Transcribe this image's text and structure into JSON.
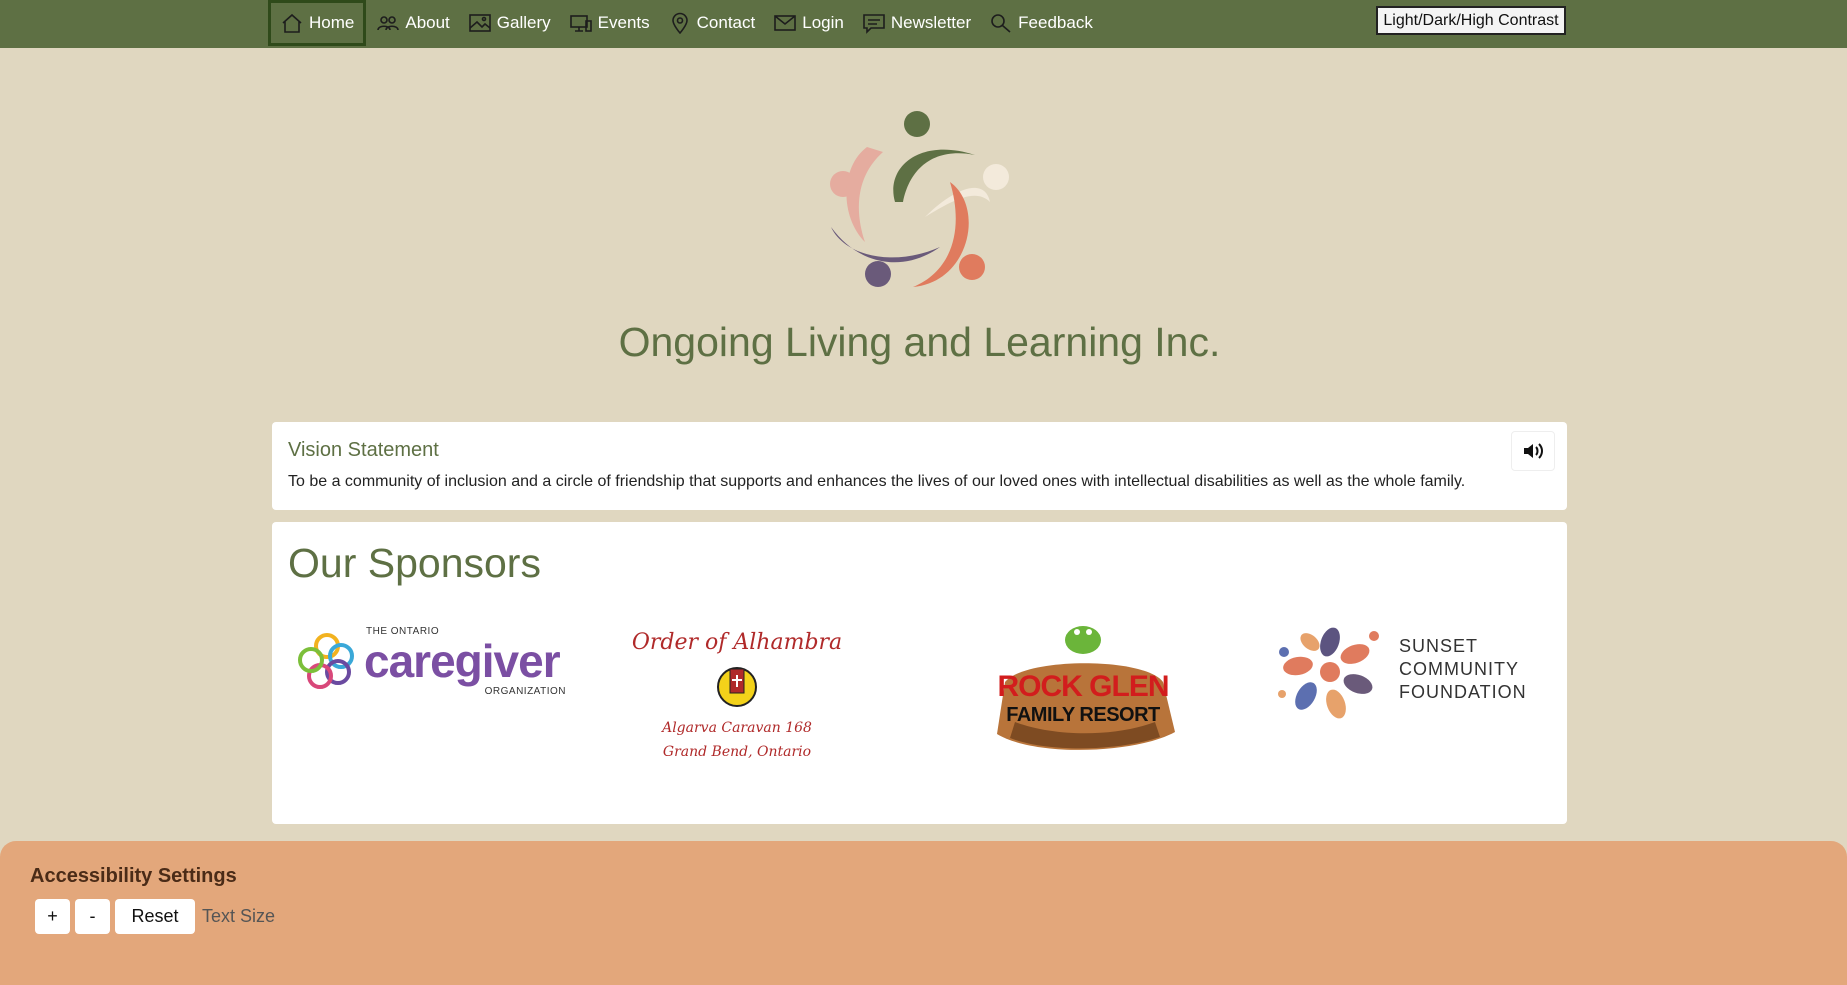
{
  "nav": {
    "items": [
      {
        "label": "Home",
        "icon": "home-icon"
      },
      {
        "label": "About",
        "icon": "people-icon"
      },
      {
        "label": "Gallery",
        "icon": "image-icon"
      },
      {
        "label": "Events",
        "icon": "devices-icon"
      },
      {
        "label": "Contact",
        "icon": "map-pin-icon"
      },
      {
        "label": "Login",
        "icon": "envelope-icon"
      },
      {
        "label": "Newsletter",
        "icon": "chat-icon"
      },
      {
        "label": "Feedback",
        "icon": "search-icon"
      }
    ],
    "active": "Home",
    "contrast_button": "Light/Dark/High Contrast"
  },
  "hero": {
    "title": "Ongoing Living and Learning Inc."
  },
  "vision": {
    "title": "Vision Statement",
    "text": "To be a community of inclusion and a circle of friendship that supports and enhances the lives of our loved ones with intellectual disabilities as well as the whole family."
  },
  "sponsors": {
    "title": "Our Sponsors",
    "caregiver": {
      "small": "THE ONTARIO",
      "big": "caregiver",
      "sub": "ORGANIZATION"
    },
    "alhambra": {
      "title": "Order of Alhambra",
      "line1": "Algarva Caravan 168",
      "line2": "Grand Bend, Ontario"
    },
    "rockglen": {
      "line1": "ROCK GLEN",
      "line2": "FAMILY RESORT"
    },
    "sunset": {
      "line1": "SUNSET",
      "line2": "COMMUNITY",
      "line3": "FOUNDATION"
    }
  },
  "accessibility": {
    "title": "Accessibility Settings",
    "plus": "+",
    "minus": "-",
    "reset": "Reset",
    "label": "Text Size"
  },
  "colors": {
    "nav_bg": "#5e7044",
    "page_bg": "#e0d7c0",
    "accent_green": "#5e7044",
    "footer_bg": "#e3a77b"
  }
}
